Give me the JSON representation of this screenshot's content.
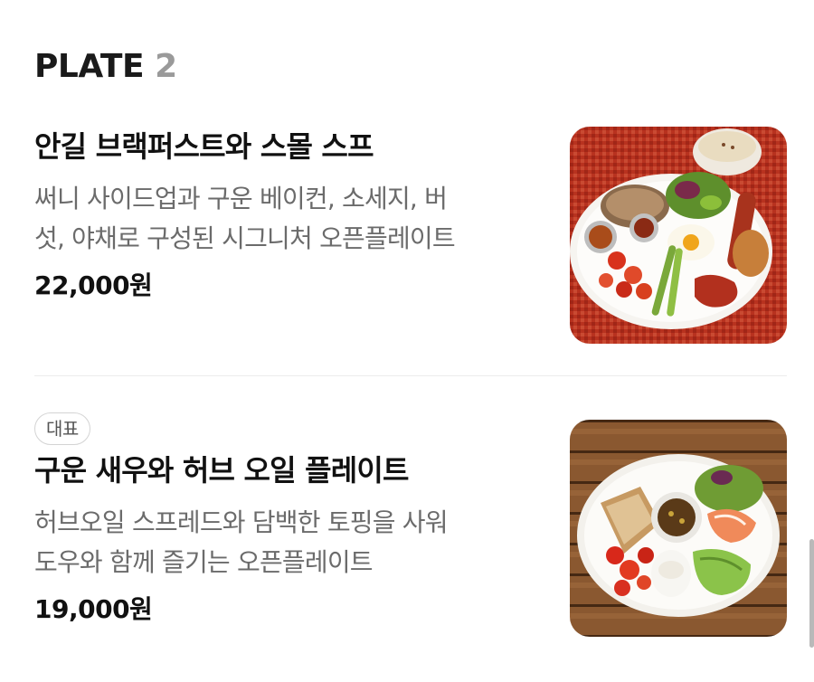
{
  "section": {
    "title": "PLATE",
    "number": "2"
  },
  "items": [
    {
      "name": "안길 브랙퍼스트와 스몰 스프",
      "desc_line1": "써니 사이드업과 구운 베이컨, 소세지, 버",
      "desc_line2": "섯, 야채로 구성된 시그니처 오픈플레이트",
      "price": "22,000원",
      "badge": ""
    },
    {
      "name": "구운 새우와 허브 오일 플레이트",
      "desc_line1": "허브오일 스프레드와 담백한 토핑을 사워",
      "desc_line2": "도우와 함께 즐기는 오픈플레이트",
      "price": "19,000원",
      "badge": "대표"
    }
  ]
}
